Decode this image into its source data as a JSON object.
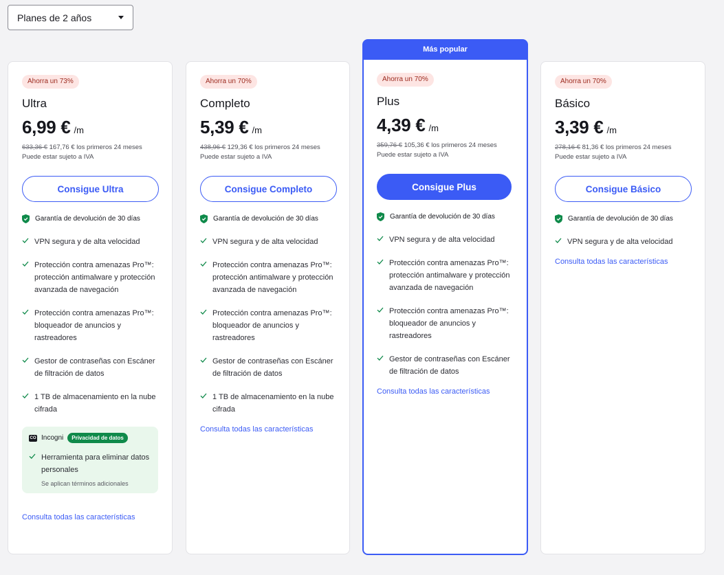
{
  "selector": {
    "value": "Planes de 2 años"
  },
  "guarantee_text": "Garantía de devolución de 30 días",
  "all_features_link": "Consulta todas las características",
  "popular_label": "Más popular",
  "colors": {
    "accent": "#3b5bf5",
    "check": "#0f8a4a",
    "badge_bg": "#fde5e3",
    "incogni_bg": "#e9f7ec"
  },
  "plans": [
    {
      "badge": "Ahorra un 73%",
      "name": "Ultra",
      "price": "6,99 €",
      "per": "/m",
      "old_price": "633,36 €",
      "new_price": "167,76 €",
      "period_text": "los primeros 24 meses",
      "tax_note": "Puede estar sujeto a IVA",
      "button": "Consigue Ultra",
      "features": [
        "VPN segura y de alta velocidad",
        "Protección contra amenazas Pro™: protección antimalware y protección avanzada de navegación",
        "Protección contra amenazas Pro™: bloqueador de anuncios y rastreadores",
        "Gestor de contraseñas con Escáner de filtración de datos",
        "1 TB de almacenamiento en la nube cifrada"
      ],
      "incogni": {
        "logo_text": "CO",
        "name": "Incogni",
        "tag": "Privacidad de datos",
        "feature": "Herramienta para eliminar datos personales",
        "note": "Se aplican términos adicionales"
      }
    },
    {
      "badge": "Ahorra un 70%",
      "name": "Completo",
      "price": "5,39 €",
      "per": "/m",
      "old_price": "438,96 €",
      "new_price": "129,36 €",
      "period_text": "los primeros 24 meses",
      "tax_note": "Puede estar sujeto a IVA",
      "button": "Consigue Completo",
      "features": [
        "VPN segura y de alta velocidad",
        "Protección contra amenazas Pro™: protección antimalware y protección avanzada de navegación",
        "Protección contra amenazas Pro™: bloqueador de anuncios y rastreadores",
        "Gestor de contraseñas con Escáner de filtración de datos",
        "1 TB de almacenamiento en la nube cifrada"
      ]
    },
    {
      "badge": "Ahorra un 70%",
      "name": "Plus",
      "price": "4,39 €",
      "per": "/m",
      "old_price": "359,76 €",
      "new_price": "105,36 €",
      "period_text": "los primeros 24 meses",
      "tax_note": "Puede estar sujeto a IVA",
      "button": "Consigue Plus",
      "features": [
        "VPN segura y de alta velocidad",
        "Protección contra amenazas Pro™: protección antimalware y protección avanzada de navegación",
        "Protección contra amenazas Pro™: bloqueador de anuncios y rastreadores",
        "Gestor de contraseñas con Escáner de filtración de datos"
      ]
    },
    {
      "badge": "Ahorra un 70%",
      "name": "Básico",
      "price": "3,39 €",
      "per": "/m",
      "old_price": "278,16 €",
      "new_price": "81,36 €",
      "period_text": "los primeros 24 meses",
      "tax_note": "Puede estar sujeto a IVA",
      "button": "Consigue Básico",
      "features": [
        "VPN segura y de alta velocidad"
      ]
    }
  ]
}
